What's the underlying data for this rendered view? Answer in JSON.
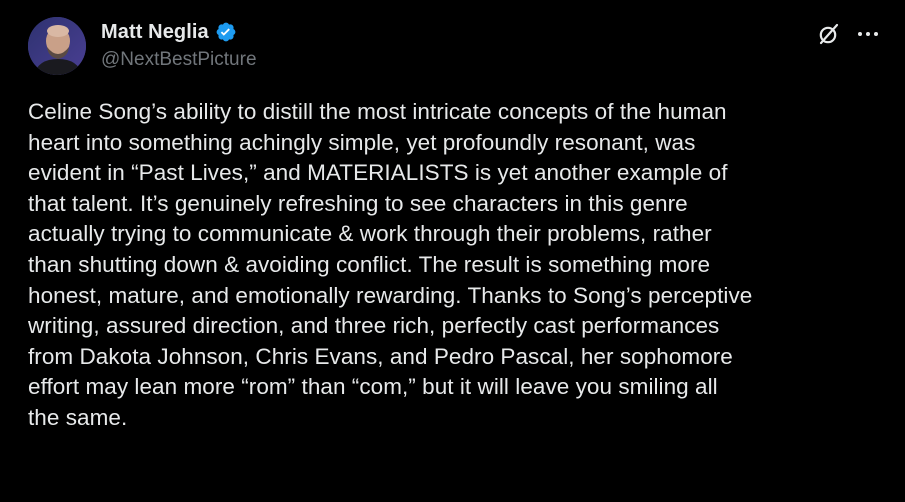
{
  "colors": {
    "background": "#000000",
    "text_primary": "#e7e9ea",
    "text_secondary": "#71767b",
    "verified_badge": "#1d9bf0"
  },
  "post": {
    "author": {
      "display_name": "Matt Neglia",
      "handle": "@NextBestPicture",
      "verified": true,
      "avatar_icon": "profile-photo"
    },
    "actions": {
      "grok_icon": "grok-icon",
      "more_icon": "more-horizontal-icon"
    },
    "text": "Celine Song’s ability to distill the most intricate concepts of the human\nheart into something achingly simple, yet profoundly resonant, was\nevident in “Past Lives,” and MATERIALISTS is yet another example of\nthat talent. It’s genuinely refreshing to see characters in this genre\nactually trying to communicate & work through their problems, rather\nthan shutting down & avoiding conflict. The result is something more\nhonest, mature, and emotionally rewarding. Thanks to Song’s perceptive\nwriting, assured direction, and three rich, perfectly cast performances\nfrom Dakota Johnson, Chris Evans, and Pedro Pascal, her sophomore\neffort may lean more “rom” than “com,” but it will leave you smiling all\nthe same."
  }
}
